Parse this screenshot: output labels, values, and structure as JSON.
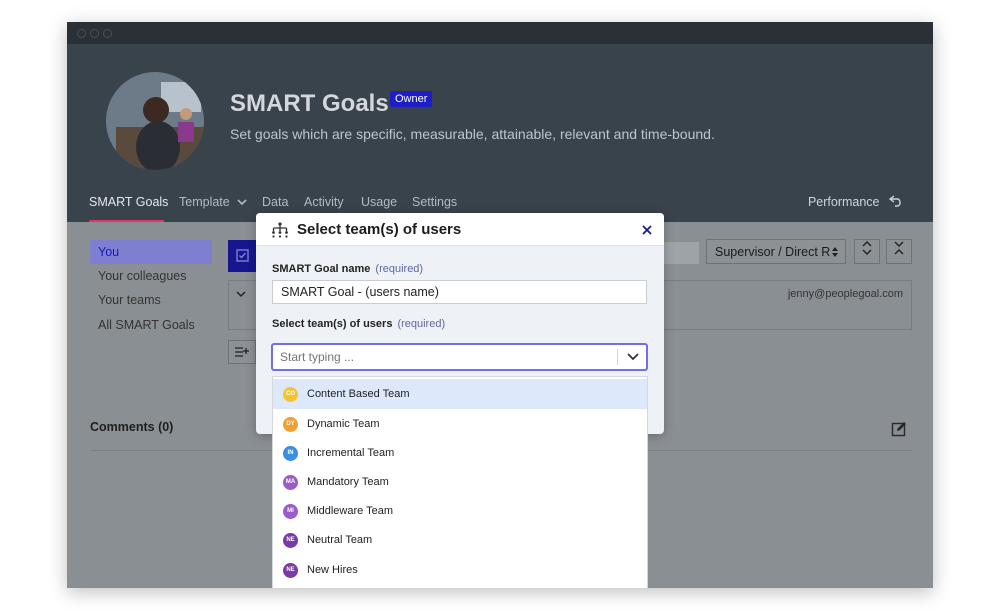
{
  "header": {
    "title": "SMART Goals",
    "owner_badge": "Owner",
    "subtitle": "Set goals which are specific, measurable, attainable, relevant and time-bound."
  },
  "tabs": [
    {
      "label": "SMART Goals"
    },
    {
      "label": "Template"
    },
    {
      "label": "Data"
    },
    {
      "label": "Activity"
    },
    {
      "label": "Usage"
    },
    {
      "label": "Settings"
    }
  ],
  "performance_label": "Performance",
  "sidebar": {
    "items": [
      {
        "label": "You"
      },
      {
        "label": "Your colleagues"
      },
      {
        "label": "Your teams"
      },
      {
        "label": "All SMART Goals"
      }
    ]
  },
  "toolbar": {
    "sort_select": "Supervisor / Direct R"
  },
  "panel": {
    "email": "jenny@peoplegoal.com"
  },
  "comments": {
    "label": "Comments (0)"
  },
  "modal": {
    "title": "Select team(s) of users",
    "name_label": "SMART Goal name",
    "name_required": "(required)",
    "name_value": "SMART Goal - (users name)",
    "teams_label": "Select team(s) of users",
    "teams_required": "(required)",
    "teams_placeholder": "Start typing ...",
    "options": [
      {
        "initials": "CO",
        "label": "Content Based Team",
        "color": "#f4c430"
      },
      {
        "initials": "DY",
        "label": "Dynamic Team",
        "color": "#f0a030"
      },
      {
        "initials": "IN",
        "label": "Incremental Team",
        "color": "#3a8fe0"
      },
      {
        "initials": "MA",
        "label": "Mandatory Team",
        "color": "#9a5cc8"
      },
      {
        "initials": "MI",
        "label": "Middleware Team",
        "color": "#9a5cc8"
      },
      {
        "initials": "NE",
        "label": "Neutral Team",
        "color": "#7a3aa8"
      },
      {
        "initials": "NE",
        "label": "New Hires",
        "color": "#7a3aa8"
      }
    ]
  },
  "colors": {
    "header_bg": "#39434c",
    "accent_pink": "#e0346c",
    "owner_badge": "#1e1ec9",
    "focus_border": "#6f6fe8",
    "highlight_row": "#dde9fb"
  }
}
